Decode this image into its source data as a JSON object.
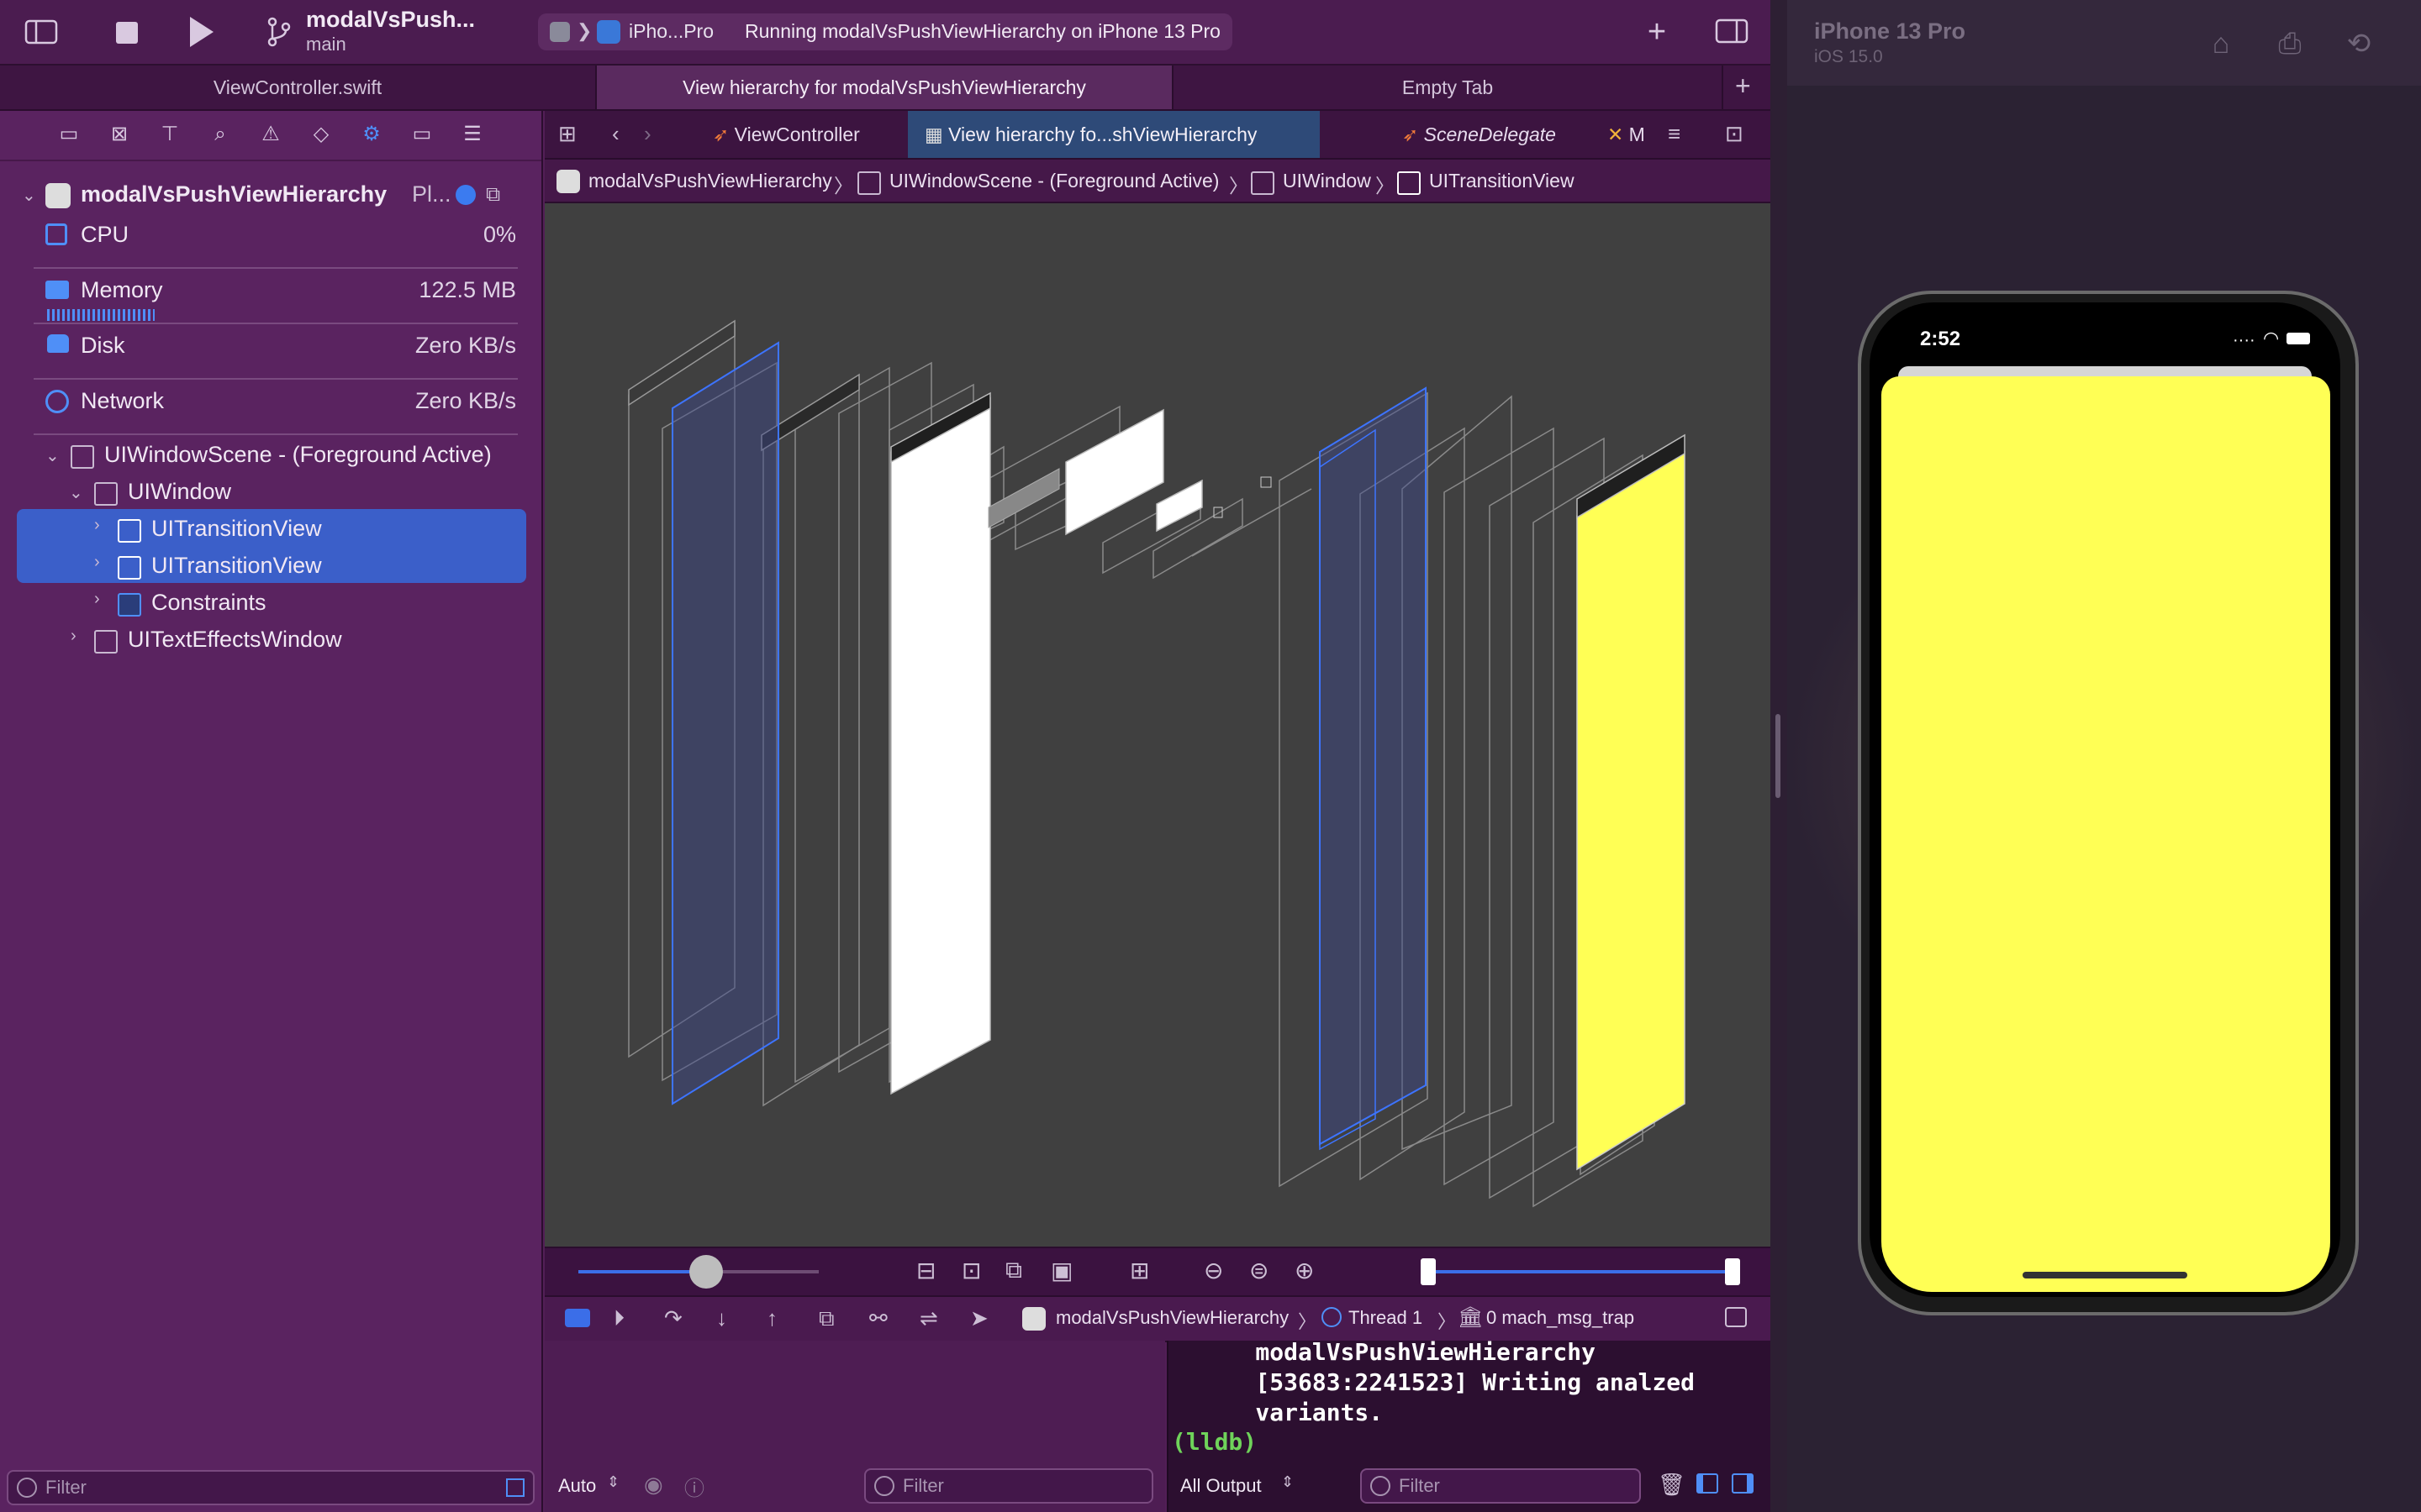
{
  "toolbar": {
    "scheme_name": "modalVsPush...",
    "branch": "main",
    "destination": "iPho...Pro",
    "status": "Running modalVsPushViewHierarchy on iPhone 13 Pro"
  },
  "window_tabs": [
    "ViewController.swift",
    "View hierarchy for modalVsPushViewHierarchy",
    "Empty Tab"
  ],
  "navigator": {
    "project": "modalVsPushViewHierarchy",
    "project_suffix": "Pl...",
    "gauges": [
      {
        "label": "CPU",
        "value": "0%"
      },
      {
        "label": "Memory",
        "value": "122.5 MB"
      },
      {
        "label": "Disk",
        "value": "Zero KB/s"
      },
      {
        "label": "Network",
        "value": "Zero KB/s"
      }
    ],
    "tree": [
      "UIWindowScene - (Foreground Active)",
      "UIWindow",
      "UITransitionView",
      "UITransitionView",
      "Constraints",
      "UITextEffectsWindow"
    ],
    "filter_placeholder": "Filter"
  },
  "editor_tabs": [
    "ViewController",
    "View hierarchy fo...shViewHierarchy",
    "SceneDelegate",
    "M"
  ],
  "jumpbar": [
    "modalVsPushViewHierarchy",
    "UIWindowScene - (Foreground Active)",
    "UIWindow",
    "UITransitionView"
  ],
  "debugbar": {
    "target": "modalVsPushViewHierarchy",
    "thread": "Thread 1",
    "frame": "0 mach_msg_trap"
  },
  "console": {
    "text": "    modalVsPushViewHierarchy\n    [53683:2241523] Writing analzed\n    variants.",
    "prompt": "(lldb)"
  },
  "bottom": {
    "auto": "Auto",
    "vars_filter": "Filter",
    "output": "All Output",
    "console_filter": "Filter"
  },
  "colors": {
    "accent": "#3b5fc9",
    "selected_view": "#ffff55",
    "navigator_bg": "#5a2360"
  },
  "simulator": {
    "device": "iPhone 13 Pro",
    "os": "iOS 15.0",
    "time": "2:52"
  }
}
